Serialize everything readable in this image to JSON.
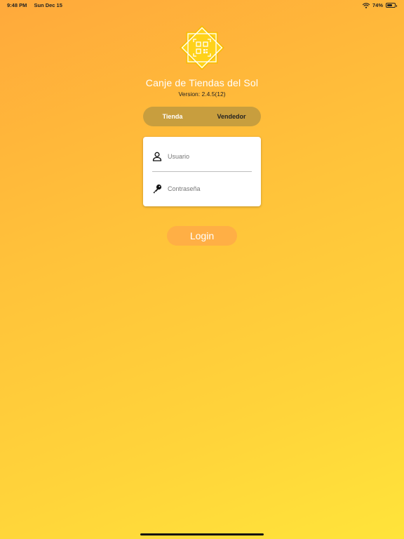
{
  "status_bar": {
    "time": "9:48 PM",
    "date": "Sun Dec 15",
    "battery": "74%",
    "battery_level": 0.74,
    "wifi_icon": "wifi-icon",
    "battery_icon": "battery-icon"
  },
  "app": {
    "logo_icon": "qr-code-star-logo",
    "title": "Canje de Tiendas del Sol",
    "version": "Version: 2.4.5(12)"
  },
  "segmented": {
    "tabs": [
      "Tienda",
      "Vendedor"
    ],
    "selected": "Tienda"
  },
  "form": {
    "username_placeholder": "Usuario",
    "username_value": "",
    "username_icon": "person-icon",
    "password_placeholder": "Contraseña",
    "password_value": "",
    "password_icon": "key-icon"
  },
  "actions": {
    "login_label": "Login"
  },
  "colors": {
    "gradient_start": "#ffa93b",
    "gradient_end": "#ffe43a",
    "segment_bg": "#c89e3e",
    "login_button": "#ffaf45",
    "logo_yellow": "#ffd21a"
  }
}
